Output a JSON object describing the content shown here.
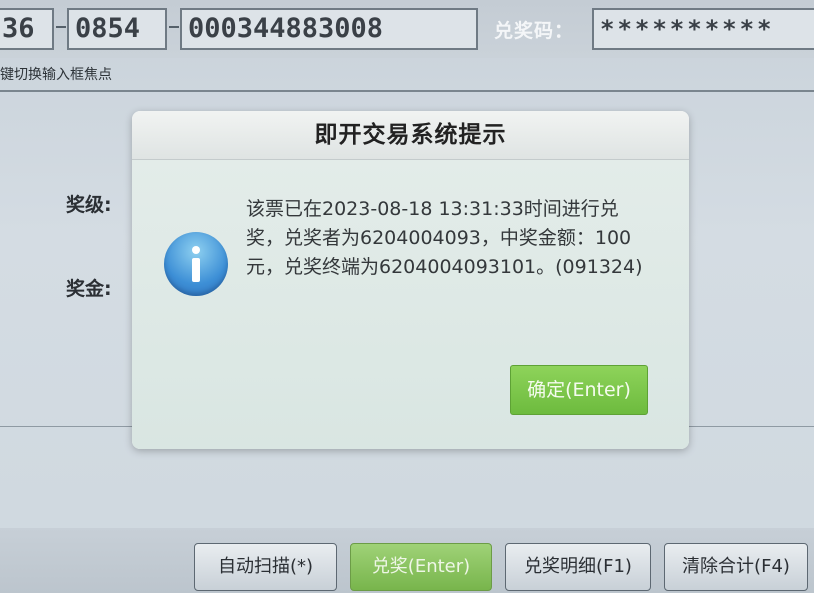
{
  "header": {
    "field1": "36",
    "field2": "0854",
    "field3": "000344883008",
    "code_label": "兑奖码：",
    "code_value": "**********",
    "hint": "键切换输入框焦点"
  },
  "labels": {
    "prize_level": "奖级:",
    "prize_amount": "奖金:"
  },
  "dialog": {
    "title": "即开交易系统提示",
    "message": "该票已在2023-08-18 13:31:33时间进行兑奖，兑奖者为6204004093，中奖金额：100元，兑奖终端为6204004093101。(091324)",
    "ok_label": "确定(Enter)",
    "icon": "info-icon"
  },
  "buttons": {
    "auto_scan": "自动扫描(*)",
    "redeem": "兑奖(Enter)",
    "details": "兑奖明细(F1)",
    "clear_total": "清除合计(F4)"
  },
  "colors": {
    "accent_green": "#78b54c",
    "info_blue": "#3d8fd6"
  }
}
